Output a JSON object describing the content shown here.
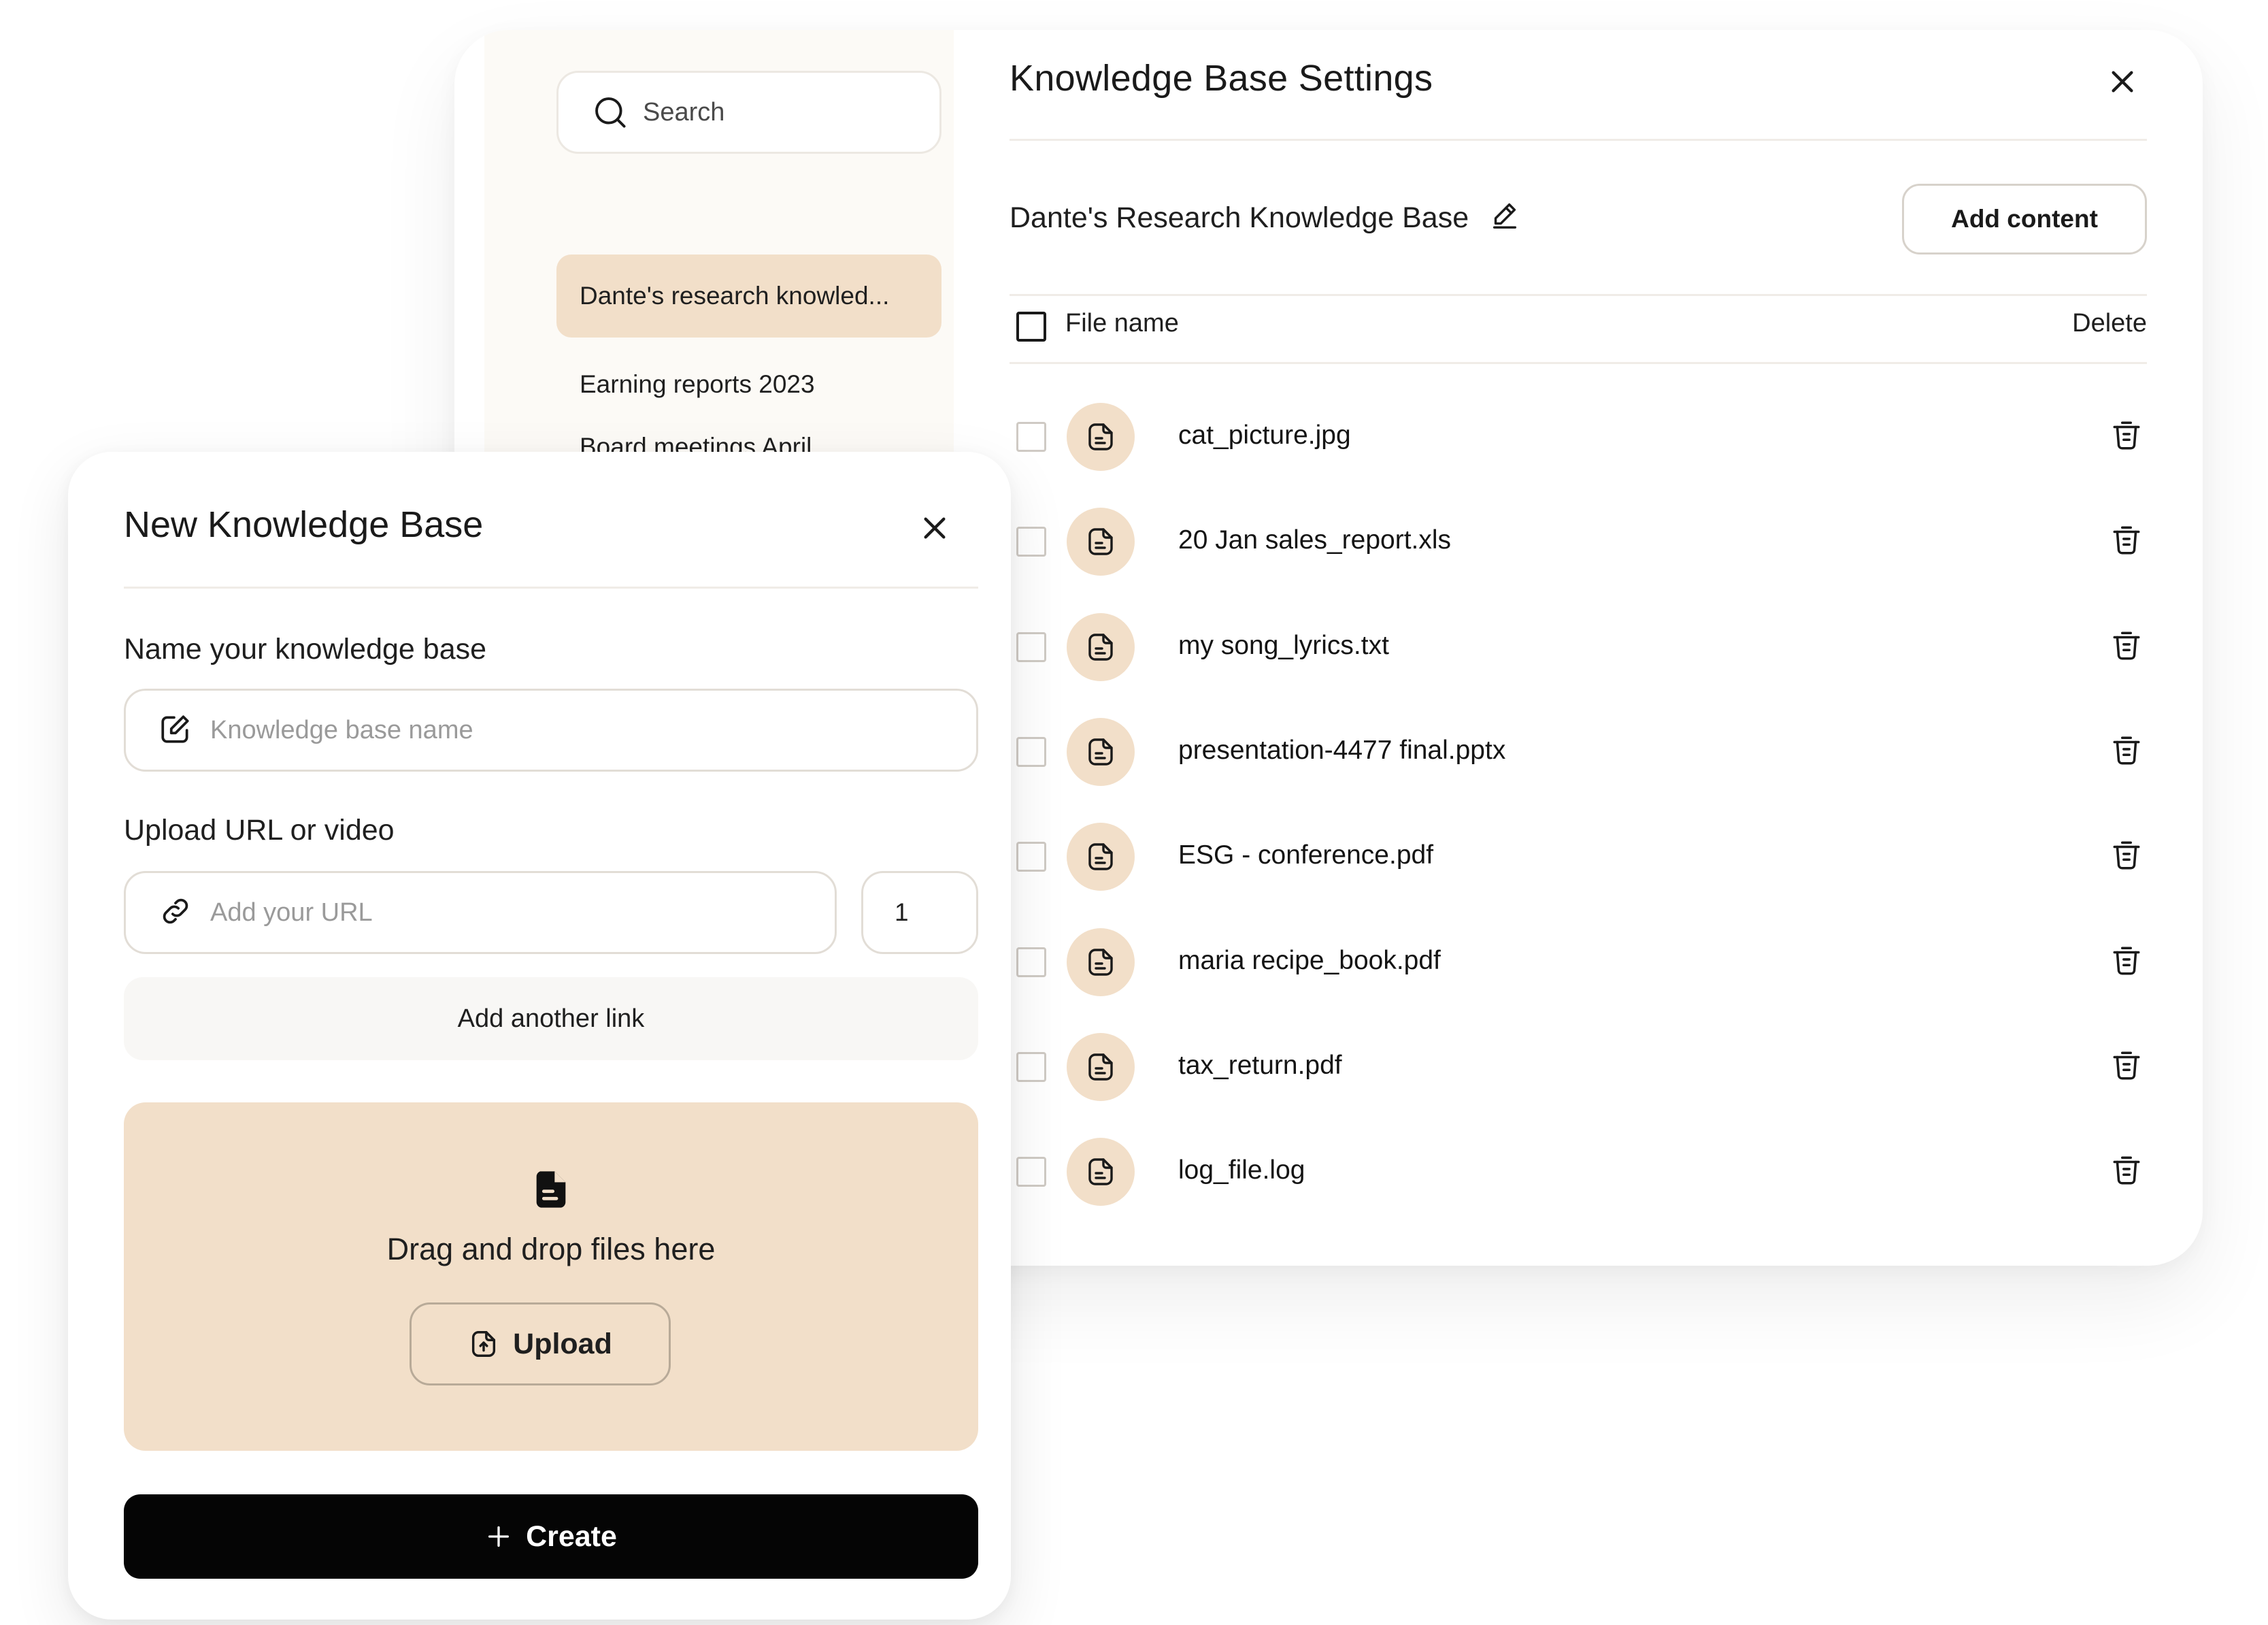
{
  "settings": {
    "title": "Knowledge Base Settings",
    "kb_name": "Dante's Research Knowledge Base",
    "add_content_label": "Add content",
    "header_file_name": "File name",
    "header_delete": "Delete",
    "files": [
      {
        "name": "cat_picture.jpg"
      },
      {
        "name": "20 Jan sales_report.xls"
      },
      {
        "name": "my song_lyrics.txt"
      },
      {
        "name": "presentation-4477 final.pptx"
      },
      {
        "name": "ESG - conference.pdf"
      },
      {
        "name": "maria recipe_book.pdf"
      },
      {
        "name": "tax_return.pdf"
      },
      {
        "name": "log_file.log"
      }
    ]
  },
  "sidebar": {
    "search_placeholder": "Search",
    "items": [
      {
        "label": "Dante's research knowled...",
        "active": true
      },
      {
        "label": "Earning reports 2023",
        "active": false
      },
      {
        "label": "Board meetings April",
        "active": false
      }
    ]
  },
  "new_kb": {
    "title": "New Knowledge Base",
    "name_label": "Name your knowledge base",
    "name_placeholder": "Knowledge base name",
    "url_label": "Upload URL or video",
    "url_placeholder": "Add your URL",
    "url_count": "1",
    "add_link_label": "Add another link",
    "drop_text": "Drag and drop files here",
    "upload_label": "Upload",
    "create_label": "Create"
  },
  "icons": {
    "search": "search-icon",
    "close": "close-icon",
    "edit": "pencil-icon",
    "file": "document-icon",
    "trash": "trash-icon",
    "link": "link-icon",
    "upload": "file-upload-icon",
    "plus": "plus-icon"
  },
  "colors": {
    "accent_beige": "#f2dfc9",
    "sidebar_bg": "#fcfaf6",
    "primary_button": "#050505"
  }
}
